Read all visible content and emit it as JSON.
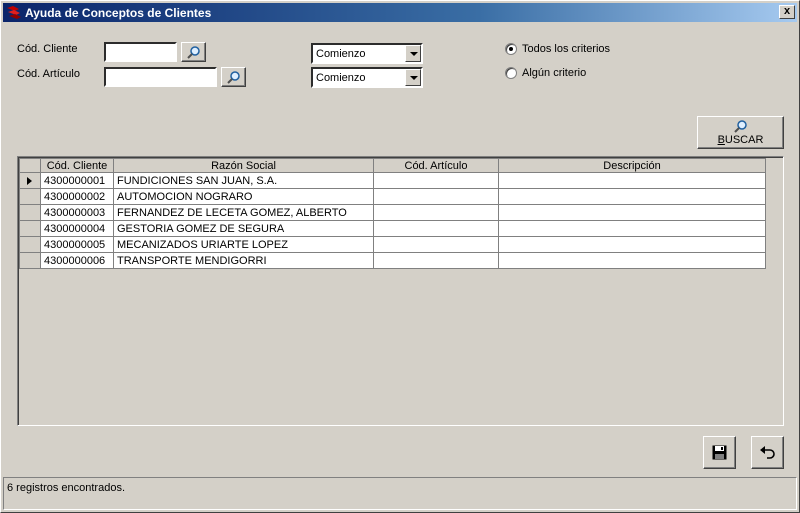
{
  "window": {
    "title": "Ayuda de Conceptos de Clientes",
    "close_label": "x"
  },
  "filters": {
    "cliente_label": "Cód. Cliente",
    "cliente_value": "",
    "articulo_label": "Cód. Artículo",
    "articulo_value": "",
    "cliente_match": "Comienzo",
    "articulo_match": "Comienzo"
  },
  "criteria": {
    "all_label": "Todos los criterios",
    "any_label": "Algún criterio",
    "selected": "all"
  },
  "search": {
    "label": "BUSCAR"
  },
  "table": {
    "columns": [
      "Cód. Cliente",
      "Razón Social",
      "Cód. Artículo",
      "Descripción"
    ],
    "rows": [
      [
        "4300000001",
        "FUNDICIONES SAN JUAN, S.A.",
        "",
        ""
      ],
      [
        "4300000002",
        "AUTOMOCION NOGRARO",
        "",
        ""
      ],
      [
        "4300000003",
        "FERNANDEZ DE LECETA GOMEZ, ALBERTO",
        "",
        ""
      ],
      [
        "4300000004",
        "GESTORIA GOMEZ DE SEGURA",
        "",
        ""
      ],
      [
        "4300000005",
        "MECANIZADOS URIARTE LOPEZ",
        "",
        ""
      ],
      [
        "4300000006",
        "TRANSPORTE MENDIGORRI",
        "",
        ""
      ]
    ],
    "current_row": 0
  },
  "actions": {
    "save_icon": "floppy-disk-icon",
    "undo_icon": "undo-icon"
  },
  "status": {
    "text": "6 registros encontrados."
  }
}
